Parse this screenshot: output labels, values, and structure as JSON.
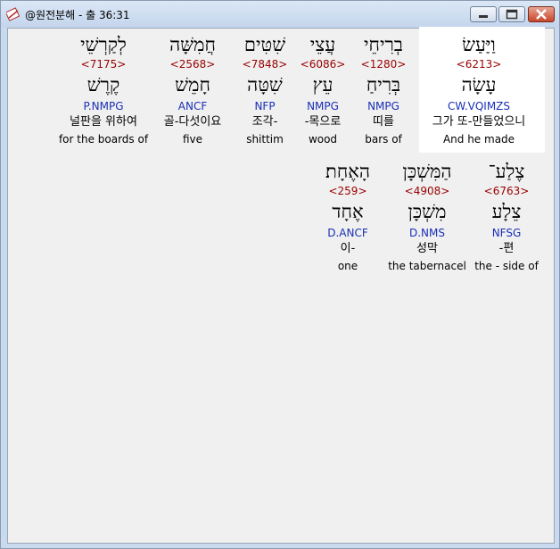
{
  "window": {
    "title": "@원전분해 - 출 36:31",
    "icon": "bible-app-icon"
  },
  "rows": [
    {
      "words": [
        {
          "hebrew": "וַיַּעַשׂ",
          "strong": "<6213>",
          "lemma": "עָשָׂה",
          "morph": "CW.VQIMZS",
          "korean": "그가 또-만들었으니",
          "english": "And he made",
          "selected": true
        },
        {
          "hebrew": "בְרִיחֵי",
          "strong": "<1280>",
          "lemma": "בְּרִיחַ",
          "morph": "NMPG",
          "korean": "띠를",
          "english": "bars of"
        },
        {
          "hebrew": "עֲצֵי",
          "strong": "<6086>",
          "lemma": "עֵץ",
          "morph": "NMPG",
          "korean": "-목으로",
          "english": "wood"
        },
        {
          "hebrew": "שִׁטִּים",
          "strong": "<7848>",
          "lemma": "שִׁטָּה",
          "morph": "NFP",
          "korean": "조각-",
          "english": "shittim"
        },
        {
          "hebrew": "חֲמִשָּׁה",
          "strong": "<2568>",
          "lemma": "חָמֵשׁ",
          "morph": "ANCF",
          "korean": "골-다섯이요",
          "english": "five"
        },
        {
          "hebrew": "לְקַרְשֵׁי",
          "strong": "<7175>",
          "lemma": "קֶרֶשׁ",
          "morph": "P.NMPG",
          "korean": "널판을 위하여",
          "english": "for the boards of"
        }
      ]
    },
    {
      "words": [
        {
          "hebrew": "צֶלַע־",
          "strong": "<6763>",
          "lemma": "צֵלָע",
          "morph": "NFSG",
          "korean": "-편",
          "english": "the - side of"
        },
        {
          "hebrew": "הַמִּשְׁכָּן",
          "strong": "<4908>",
          "lemma": "מִשְׁכָּן",
          "morph": "D.NMS",
          "korean": "성막",
          "english": "the tabernacel"
        },
        {
          "hebrew": "הָאֶחָת׃",
          "strong": "<259>",
          "lemma": "אֶחָד",
          "morph": "D.ANCF",
          "korean": "이-",
          "english": "one"
        }
      ]
    }
  ]
}
